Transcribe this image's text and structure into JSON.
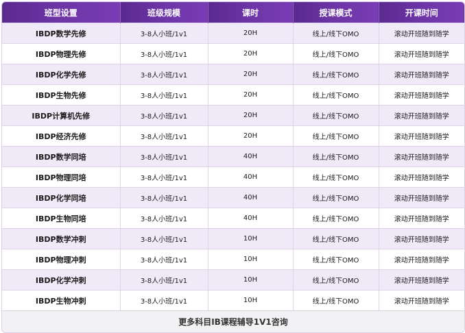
{
  "headers": [
    "班型设置",
    "班级规模",
    "课时",
    "授课模式",
    "开课时间"
  ],
  "rows": [
    {
      "name": "IBDP数学先修",
      "size": "3-8人小班/1v1",
      "hours": "20H",
      "mode": "线上/线下OMO",
      "start": "滚动开班随到随学"
    },
    {
      "name": "IBDP物理先修",
      "size": "3-8人小班/1v1",
      "hours": "20H",
      "mode": "线上/线下OMO",
      "start": "滚动开班随到随学"
    },
    {
      "name": "IBDP化学先修",
      "size": "3-8人小班/1v1",
      "hours": "20H",
      "mode": "线上/线下OMO",
      "start": "滚动开班随到随学"
    },
    {
      "name": "IBDP生物先修",
      "size": "3-8人小班/1v1",
      "hours": "20H",
      "mode": "线上/线下OMO",
      "start": "滚动开班随到随学"
    },
    {
      "name": "IBDP计算机先修",
      "size": "3-8人小班/1v1",
      "hours": "20H",
      "mode": "线上/线下OMO",
      "start": "滚动开班随到随学"
    },
    {
      "name": "IBDP经济先修",
      "size": "3-8人小班/1v1",
      "hours": "20H",
      "mode": "线上/线下OMO",
      "start": "滚动开班随到随学"
    },
    {
      "name": "IBDP数学同培",
      "size": "3-8人小班/1v1",
      "hours": "40H",
      "mode": "线上/线下OMO",
      "start": "滚动开班随到随学"
    },
    {
      "name": "IBDP物理同培",
      "size": "3-8人小班/1v1",
      "hours": "40H",
      "mode": "线上/线下OMO",
      "start": "滚动开班随到随学"
    },
    {
      "name": "IBDP化学同培",
      "size": "3-8人小班/1v1",
      "hours": "40H",
      "mode": "线上/线下OMO",
      "start": "滚动开班随到随学"
    },
    {
      "name": "IBDP生物同培",
      "size": "3-8人小班/1v1",
      "hours": "40H",
      "mode": "线上/线下OMO",
      "start": "滚动开班随到随学"
    },
    {
      "name": "IBDP数学冲刺",
      "size": "3-8人小班/1v1",
      "hours": "10H",
      "mode": "线上/线下OMO",
      "start": "滚动开班随到随学"
    },
    {
      "name": "IBDP物理冲刺",
      "size": "3-8人小班/1v1",
      "hours": "10H",
      "mode": "线上/线下OMO",
      "start": "滚动开班随到随学"
    },
    {
      "name": "IBDP化学冲刺",
      "size": "3-8人小班/1v1",
      "hours": "10H",
      "mode": "线上/线下OMO",
      "start": "滚动开班随到随学"
    },
    {
      "name": "IBDP生物冲刺",
      "size": "3-8人小班/1v1",
      "hours": "10H",
      "mode": "线上/线下OMO",
      "start": "滚动开班随到随学"
    }
  ],
  "footer": "更多科目IB课程辅导1V1咨询",
  "colors": {
    "header_start": "#5a2a8f",
    "header_end": "#7a3cb5",
    "row_alt": "#efe9f8",
    "row_plain": "#ffffff",
    "footer_bg": "#f2f2f4"
  }
}
